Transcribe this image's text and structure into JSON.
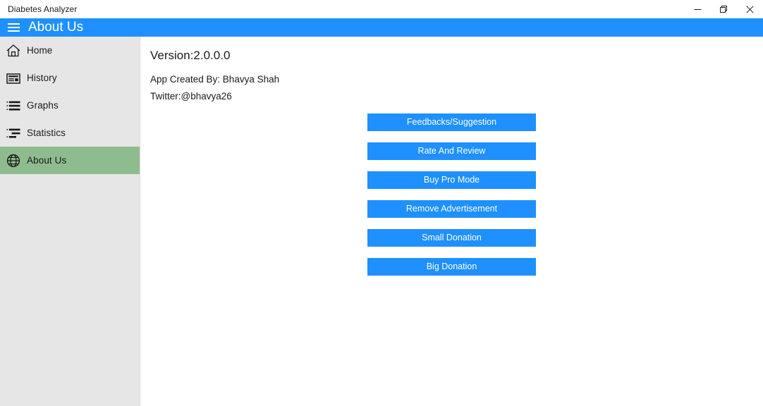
{
  "window": {
    "title": "Diabetes Analyzer",
    "controls": [
      {
        "name": "minimize",
        "label": "Minimize"
      },
      {
        "name": "maximize",
        "label": "Restore"
      },
      {
        "name": "close",
        "label": "Close"
      }
    ]
  },
  "header": {
    "menu_icon": "hamburger-icon",
    "title": "About Us",
    "background": "#1e90ff"
  },
  "sidebar": {
    "background": "#e6e6e6",
    "selected_background": "#8fbc8f",
    "items": [
      {
        "label": "Home",
        "icon": "home-icon",
        "selected": false
      },
      {
        "label": "History",
        "icon": "card-list-icon",
        "selected": false
      },
      {
        "label": "Graphs",
        "icon": "bulleted-list-icon",
        "selected": false
      },
      {
        "label": "Statistics",
        "icon": "indented-list-icon",
        "selected": false
      },
      {
        "label": "About Us",
        "icon": "globe-icon",
        "selected": true
      }
    ]
  },
  "main": {
    "version": "Version:2.0.0.0",
    "created_by": "App Created By: Bhavya Shah",
    "twitter": "Twitter:@bhavya26",
    "button_color": "#1e90ff",
    "buttons": [
      {
        "label": "Feedbacks/Suggestion"
      },
      {
        "label": "Rate And Review"
      },
      {
        "label": "Buy Pro Mode"
      },
      {
        "label": "Remove Advertisement"
      },
      {
        "label": "Small Donation"
      },
      {
        "label": "Big Donation"
      }
    ]
  }
}
